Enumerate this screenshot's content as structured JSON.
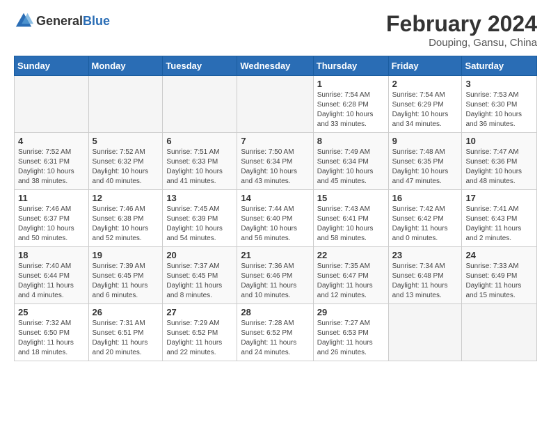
{
  "logo": {
    "general": "General",
    "blue": "Blue"
  },
  "header": {
    "month_year": "February 2024",
    "location": "Douping, Gansu, China"
  },
  "days_of_week": [
    "Sunday",
    "Monday",
    "Tuesday",
    "Wednesday",
    "Thursday",
    "Friday",
    "Saturday"
  ],
  "weeks": [
    [
      {
        "day": "",
        "info": ""
      },
      {
        "day": "",
        "info": ""
      },
      {
        "day": "",
        "info": ""
      },
      {
        "day": "",
        "info": ""
      },
      {
        "day": "1",
        "info": "Sunrise: 7:54 AM\nSunset: 6:28 PM\nDaylight: 10 hours\nand 33 minutes."
      },
      {
        "day": "2",
        "info": "Sunrise: 7:54 AM\nSunset: 6:29 PM\nDaylight: 10 hours\nand 34 minutes."
      },
      {
        "day": "3",
        "info": "Sunrise: 7:53 AM\nSunset: 6:30 PM\nDaylight: 10 hours\nand 36 minutes."
      }
    ],
    [
      {
        "day": "4",
        "info": "Sunrise: 7:52 AM\nSunset: 6:31 PM\nDaylight: 10 hours\nand 38 minutes."
      },
      {
        "day": "5",
        "info": "Sunrise: 7:52 AM\nSunset: 6:32 PM\nDaylight: 10 hours\nand 40 minutes."
      },
      {
        "day": "6",
        "info": "Sunrise: 7:51 AM\nSunset: 6:33 PM\nDaylight: 10 hours\nand 41 minutes."
      },
      {
        "day": "7",
        "info": "Sunrise: 7:50 AM\nSunset: 6:34 PM\nDaylight: 10 hours\nand 43 minutes."
      },
      {
        "day": "8",
        "info": "Sunrise: 7:49 AM\nSunset: 6:34 PM\nDaylight: 10 hours\nand 45 minutes."
      },
      {
        "day": "9",
        "info": "Sunrise: 7:48 AM\nSunset: 6:35 PM\nDaylight: 10 hours\nand 47 minutes."
      },
      {
        "day": "10",
        "info": "Sunrise: 7:47 AM\nSunset: 6:36 PM\nDaylight: 10 hours\nand 48 minutes."
      }
    ],
    [
      {
        "day": "11",
        "info": "Sunrise: 7:46 AM\nSunset: 6:37 PM\nDaylight: 10 hours\nand 50 minutes."
      },
      {
        "day": "12",
        "info": "Sunrise: 7:46 AM\nSunset: 6:38 PM\nDaylight: 10 hours\nand 52 minutes."
      },
      {
        "day": "13",
        "info": "Sunrise: 7:45 AM\nSunset: 6:39 PM\nDaylight: 10 hours\nand 54 minutes."
      },
      {
        "day": "14",
        "info": "Sunrise: 7:44 AM\nSunset: 6:40 PM\nDaylight: 10 hours\nand 56 minutes."
      },
      {
        "day": "15",
        "info": "Sunrise: 7:43 AM\nSunset: 6:41 PM\nDaylight: 10 hours\nand 58 minutes."
      },
      {
        "day": "16",
        "info": "Sunrise: 7:42 AM\nSunset: 6:42 PM\nDaylight: 11 hours\nand 0 minutes."
      },
      {
        "day": "17",
        "info": "Sunrise: 7:41 AM\nSunset: 6:43 PM\nDaylight: 11 hours\nand 2 minutes."
      }
    ],
    [
      {
        "day": "18",
        "info": "Sunrise: 7:40 AM\nSunset: 6:44 PM\nDaylight: 11 hours\nand 4 minutes."
      },
      {
        "day": "19",
        "info": "Sunrise: 7:39 AM\nSunset: 6:45 PM\nDaylight: 11 hours\nand 6 minutes."
      },
      {
        "day": "20",
        "info": "Sunrise: 7:37 AM\nSunset: 6:45 PM\nDaylight: 11 hours\nand 8 minutes."
      },
      {
        "day": "21",
        "info": "Sunrise: 7:36 AM\nSunset: 6:46 PM\nDaylight: 11 hours\nand 10 minutes."
      },
      {
        "day": "22",
        "info": "Sunrise: 7:35 AM\nSunset: 6:47 PM\nDaylight: 11 hours\nand 12 minutes."
      },
      {
        "day": "23",
        "info": "Sunrise: 7:34 AM\nSunset: 6:48 PM\nDaylight: 11 hours\nand 13 minutes."
      },
      {
        "day": "24",
        "info": "Sunrise: 7:33 AM\nSunset: 6:49 PM\nDaylight: 11 hours\nand 15 minutes."
      }
    ],
    [
      {
        "day": "25",
        "info": "Sunrise: 7:32 AM\nSunset: 6:50 PM\nDaylight: 11 hours\nand 18 minutes."
      },
      {
        "day": "26",
        "info": "Sunrise: 7:31 AM\nSunset: 6:51 PM\nDaylight: 11 hours\nand 20 minutes."
      },
      {
        "day": "27",
        "info": "Sunrise: 7:29 AM\nSunset: 6:52 PM\nDaylight: 11 hours\nand 22 minutes."
      },
      {
        "day": "28",
        "info": "Sunrise: 7:28 AM\nSunset: 6:52 PM\nDaylight: 11 hours\nand 24 minutes."
      },
      {
        "day": "29",
        "info": "Sunrise: 7:27 AM\nSunset: 6:53 PM\nDaylight: 11 hours\nand 26 minutes."
      },
      {
        "day": "",
        "info": ""
      },
      {
        "day": "",
        "info": ""
      }
    ]
  ]
}
